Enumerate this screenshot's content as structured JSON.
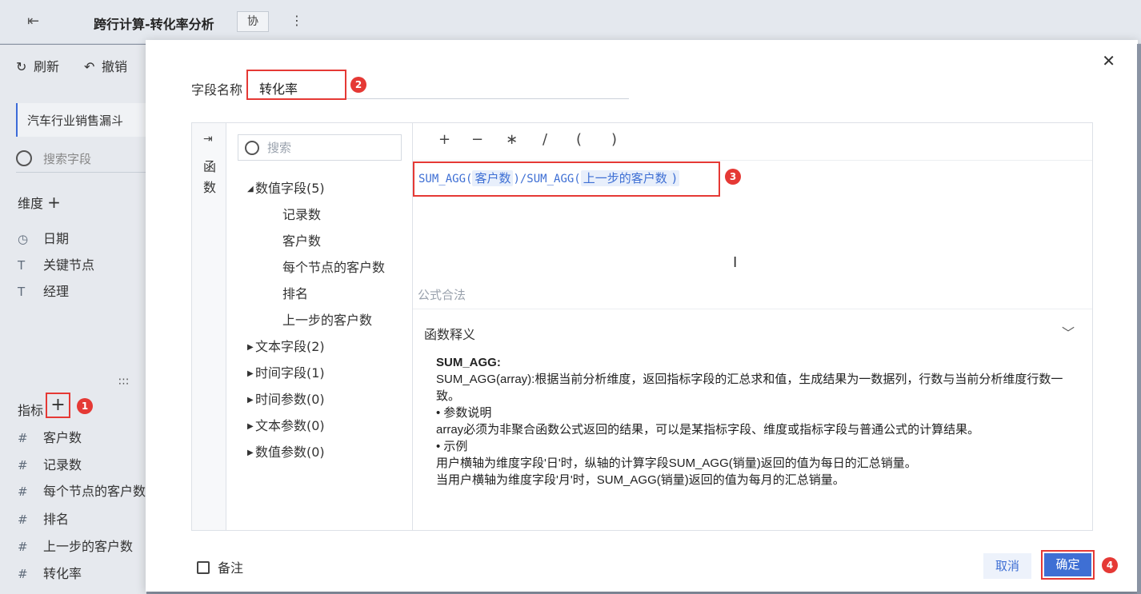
{
  "background": {
    "title": "跨行计算-转化率分析",
    "co_label": "协",
    "toolbar": {
      "refresh": "刷新",
      "undo": "撤销"
    },
    "tab_label": "汽车行业销售漏斗",
    "search_placeholder": "搜索字段",
    "dimension_label": "维度",
    "dimensions": [
      "日期",
      "关键节点",
      "经理"
    ],
    "measure_label": "指标",
    "measures": [
      "客户数",
      "记录数",
      "每个节点的客户数",
      "排名",
      "上一步的客户数",
      "转化率"
    ]
  },
  "badges": [
    "1",
    "2",
    "3",
    "4"
  ],
  "dialog": {
    "field_name_label": "字段名称",
    "field_name_value": "转化率",
    "function_tab": "函数",
    "field_search_placeholder": "搜索",
    "tree": {
      "numeric_group": "数值字段(5)",
      "numeric_fields": [
        "记录数",
        "客户数",
        "每个节点的客户数",
        "排名",
        "上一步的客户数"
      ],
      "other_groups": [
        "文本字段(2)",
        "时间字段(1)",
        "时间参数(0)",
        "文本参数(0)",
        "数值参数(0)"
      ]
    },
    "operators": [
      "+",
      "−",
      "∗",
      "/",
      "(",
      ")"
    ],
    "formula": {
      "fn1": "SUM_AGG(",
      "arg1": "客户数",
      "mid": ")/SUM_AGG(",
      "arg2": "上一步的客户数",
      "end": ")"
    },
    "status": "公式合法",
    "explain_title": "函数释义",
    "explain": {
      "name": "SUM_AGG:",
      "line1": "SUM_AGG(array):根据当前分析维度，返回指标字段的汇总求和值，生成结果为一数据列，行数与当前分析维度行数一致。",
      "param_head": "• 参数说明",
      "param": "array必须为非聚合函数公式返回的结果，可以是某指标字段、维度或指标字段与普通公式的计算结果。",
      "example_head": "• 示例",
      "example1": "用户横轴为维度字段'日'时，纵轴的计算字段SUM_AGG(销量)返回的值为每日的汇总销量。",
      "example2": "当用户横轴为维度字段'月'时，SUM_AGG(销量)返回的值为每月的汇总销量。"
    },
    "note_label": "备注",
    "cancel": "取消",
    "ok": "确定"
  }
}
